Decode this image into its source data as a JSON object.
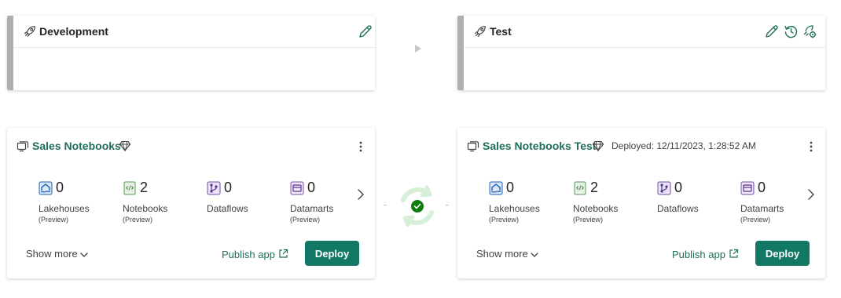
{
  "stages": [
    {
      "title": "Development"
    },
    {
      "title": "Test"
    }
  ],
  "workspaces": [
    {
      "name": "Sales Notebooks",
      "deployed": "",
      "items": [
        {
          "count": "0",
          "label": "Lakehouses",
          "sub": "(Preview)",
          "icon": "lakehouse-icon"
        },
        {
          "count": "2",
          "label": "Notebooks",
          "sub": "(Preview)",
          "icon": "notebook-icon"
        },
        {
          "count": "0",
          "label": "Dataflows",
          "sub": "",
          "icon": "dataflow-icon"
        },
        {
          "count": "0",
          "label": "Datamarts",
          "sub": "(Preview)",
          "icon": "datamart-icon"
        }
      ],
      "show_more": "Show more",
      "publish": "Publish app",
      "deploy": "Deploy"
    },
    {
      "name": "Sales Notebooks Test",
      "deployed": "Deployed: 12/11/2023, 1:28:52 AM",
      "items": [
        {
          "count": "0",
          "label": "Lakehouses",
          "sub": "(Preview)",
          "icon": "lakehouse-icon"
        },
        {
          "count": "2",
          "label": "Notebooks",
          "sub": "(Preview)",
          "icon": "notebook-icon"
        },
        {
          "count": "0",
          "label": "Dataflows",
          "sub": "",
          "icon": "dataflow-icon"
        },
        {
          "count": "0",
          "label": "Datamarts",
          "sub": "(Preview)",
          "icon": "datamart-icon"
        }
      ],
      "show_more": "Show more",
      "publish": "Publish app",
      "deploy": "Deploy"
    }
  ],
  "colors": {
    "brand": "#117865",
    "link": "#1f6e5a",
    "accent_bar": "#b1aeab",
    "sync_ok": "#107c10"
  }
}
